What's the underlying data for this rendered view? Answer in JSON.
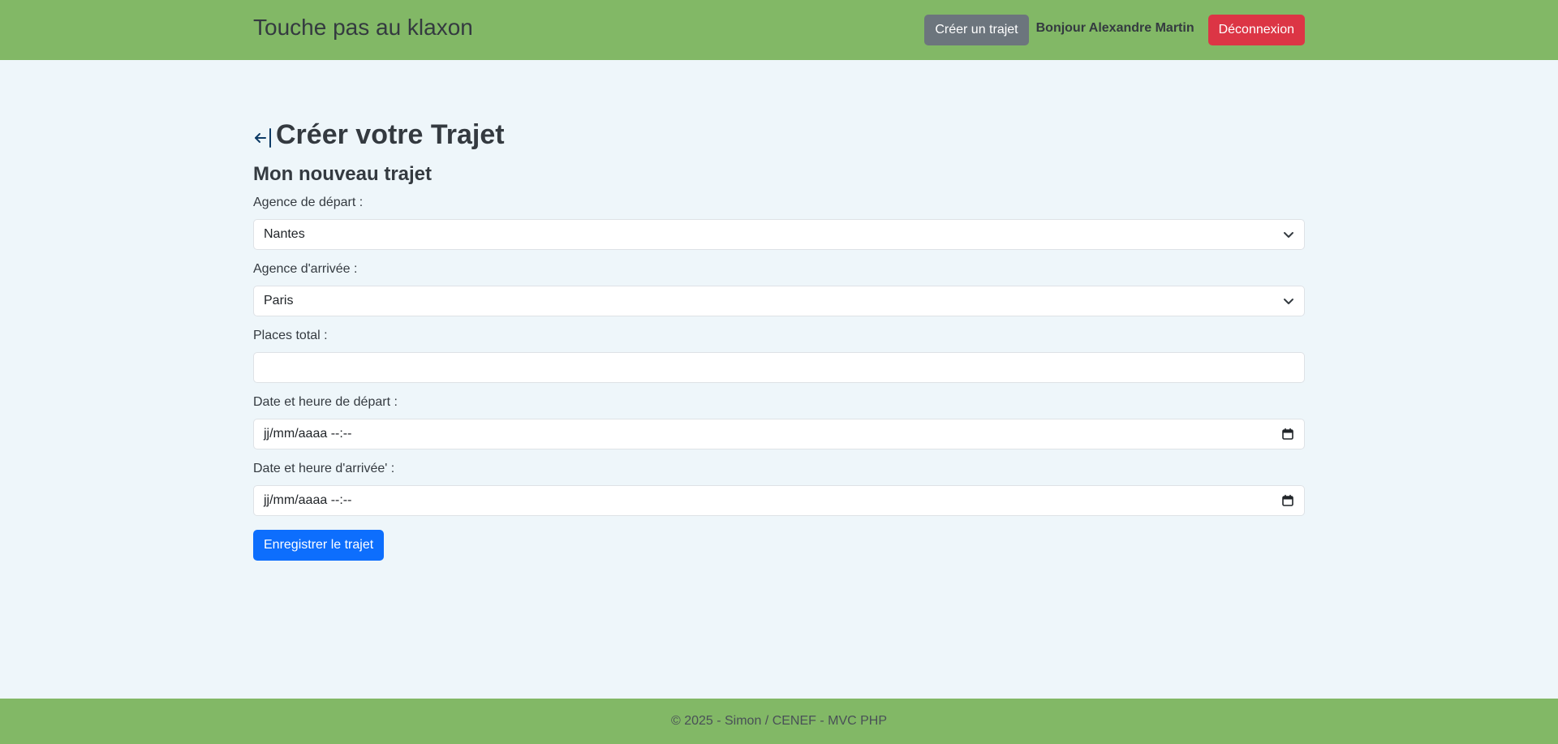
{
  "header": {
    "brand": "Touche pas au klaxon",
    "create_trip_label": "Créer un trajet",
    "greeting": "Bonjour Alexandre Martin",
    "logout_label": "Déconnexion"
  },
  "page": {
    "back_icon": "arrow-left-bar-icon",
    "title": "Créer votre Trajet",
    "subtitle": "Mon nouveau trajet"
  },
  "form": {
    "departure_agency": {
      "label": "Agence de départ :",
      "value": "Nantes"
    },
    "arrival_agency": {
      "label": "Agence d'arrivée :",
      "value": "Paris"
    },
    "seats_total": {
      "label": "Places total :",
      "value": ""
    },
    "departure_datetime": {
      "label": "Date et heure de départ :",
      "value": "jj/mm/aaaa --:--"
    },
    "arrival_datetime": {
      "label": "Date et heure d'arrivée' :",
      "value": "jj/mm/aaaa --:--"
    },
    "submit_label": "Enregistrer le trajet"
  },
  "footer": {
    "text": "© 2025 - Simon / CENEF - MVC PHP"
  },
  "colors": {
    "navbar": "#82b866",
    "background": "#eef6fa",
    "primary": "#0d6efd",
    "secondary": "#6c757d",
    "danger": "#dc3545"
  }
}
